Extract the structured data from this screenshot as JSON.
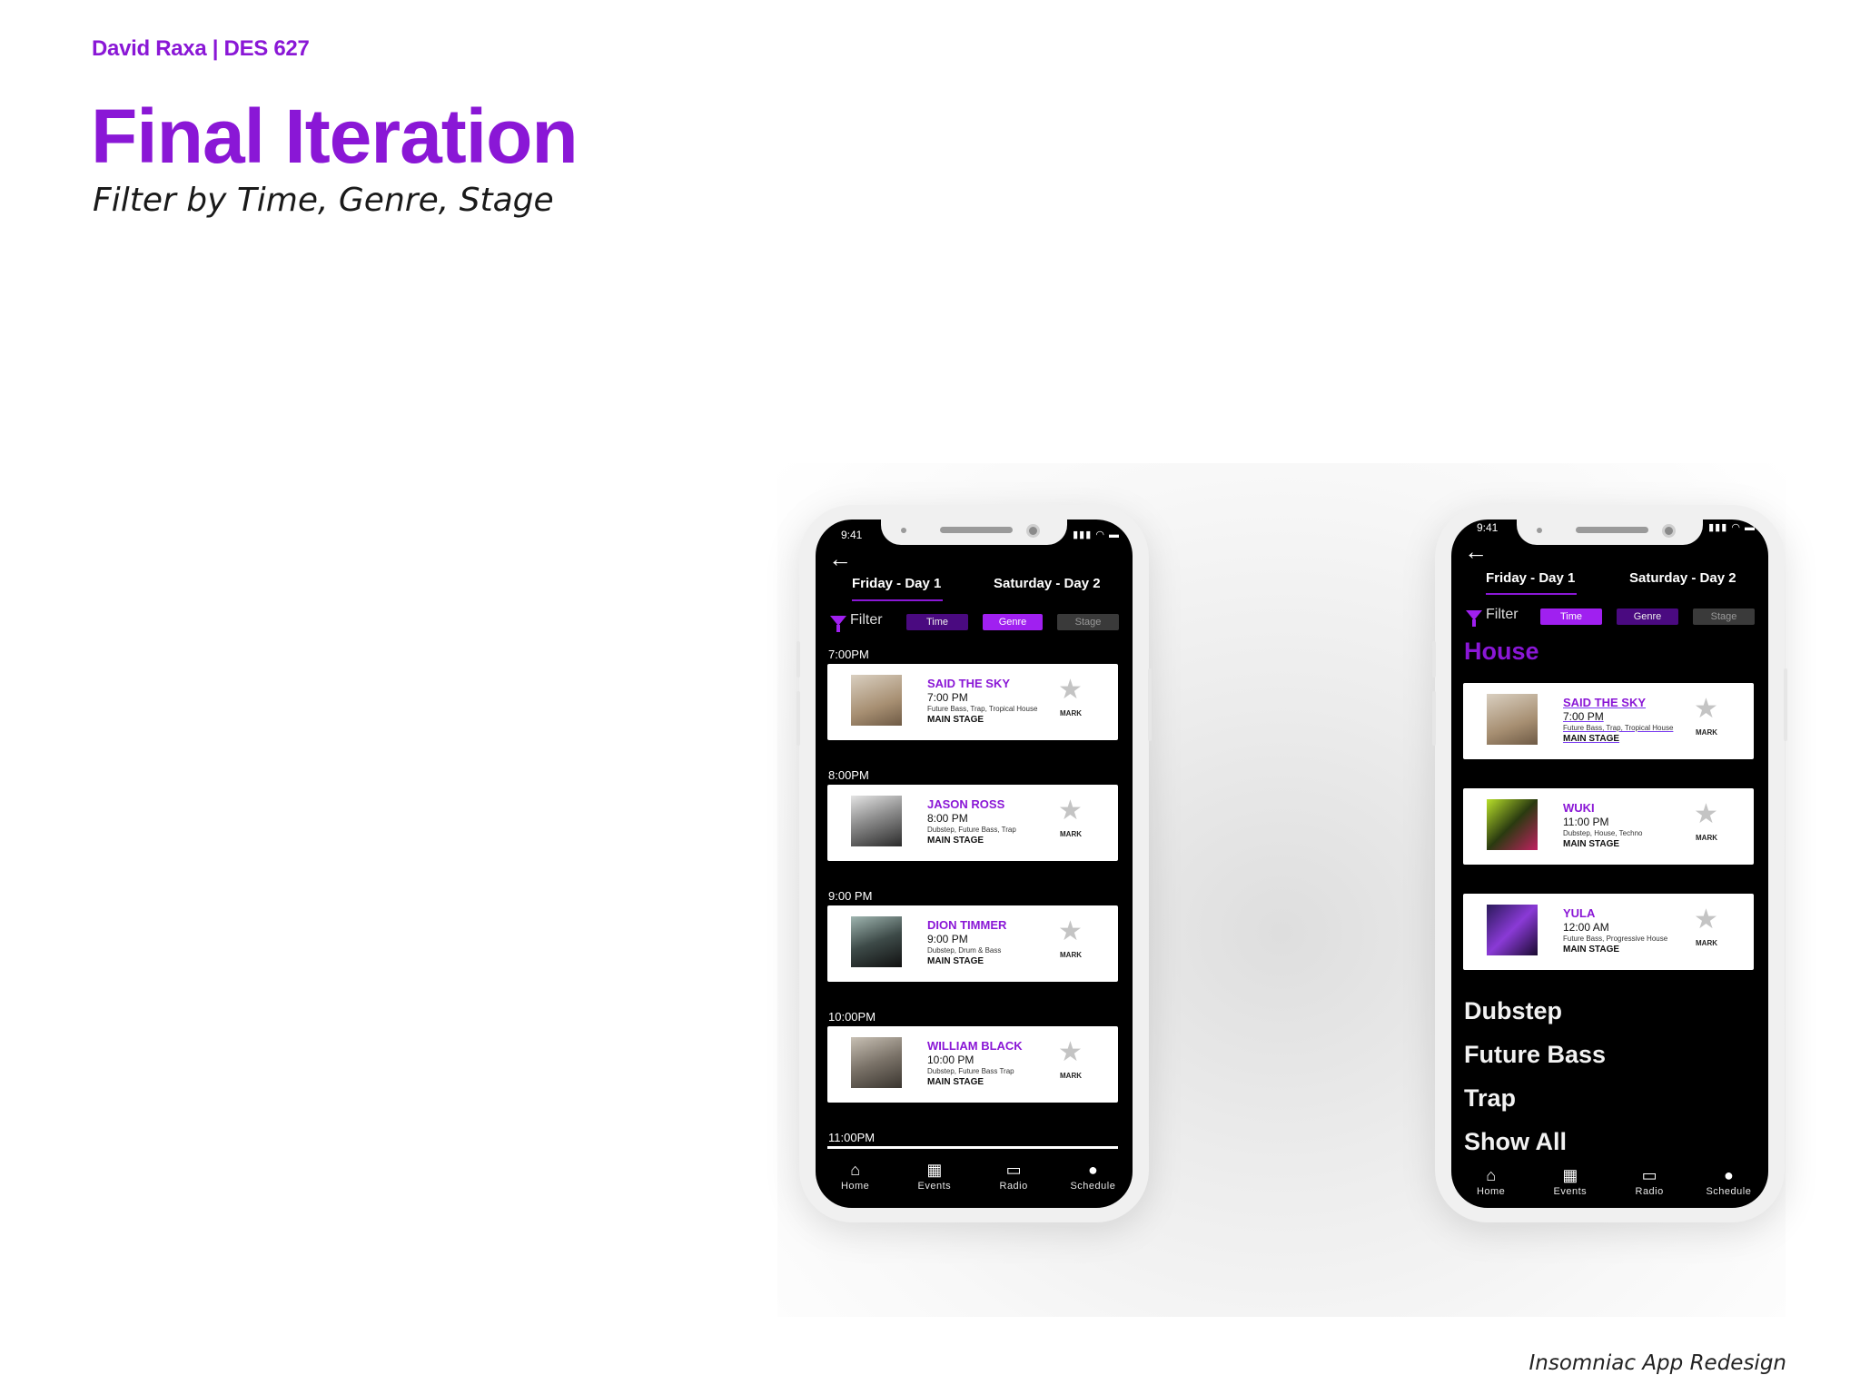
{
  "header": {
    "author": "David Raxa | DES 627",
    "title": "Final Iteration",
    "subtitle": "Filter by Time, Genre, Stage"
  },
  "footer": "Insomniac App Redesign",
  "colors": {
    "accent": "#8a17d6",
    "chip_bright": "#a020f0",
    "chip_dark": "#4a0a80"
  },
  "phone_left": {
    "status_time": "9:41",
    "tabs": [
      "Friday - Day 1",
      "Saturday - Day 2"
    ],
    "filter_label": "Filter",
    "chips": [
      "Time",
      "Genre",
      "Stage"
    ],
    "slots": [
      {
        "time": "7:00PM",
        "artist": "SAID THE SKY",
        "set_time": "7:00 PM",
        "genres": "Future Bass, Trap, Tropical House",
        "stage": "MAIN STAGE",
        "mark": "MARK"
      },
      {
        "time": "8:00PM",
        "artist": "JASON ROSS",
        "set_time": "8:00 PM",
        "genres": "Dubstep, Future Bass, Trap",
        "stage": "MAIN STAGE",
        "mark": "MARK"
      },
      {
        "time": "9:00 PM",
        "artist": "DION TIMMER",
        "set_time": "9:00 PM",
        "genres": "Dubstep, Drum & Bass",
        "stage": "MAIN STAGE",
        "mark": "MARK"
      },
      {
        "time": "10:00PM",
        "artist": "WILLIAM BLACK",
        "set_time": "10:00 PM",
        "genres": "Dubstep, Future Bass Trap",
        "stage": "MAIN STAGE",
        "mark": "MARK"
      }
    ],
    "next_time": "11:00PM",
    "nav": [
      "Home",
      "Events",
      "Radio",
      "Schedule"
    ]
  },
  "phone_right": {
    "status_time": "9:41",
    "tabs": [
      "Friday - Day 1",
      "Saturday - Day 2"
    ],
    "filter_label": "Filter",
    "chips": [
      "Time",
      "Genre",
      "Stage"
    ],
    "genre_heading": "House",
    "cards": [
      {
        "artist": "SAID THE SKY",
        "set_time": "7:00 PM",
        "genres": "Future Bass, Trap, Tropical House",
        "stage": "MAIN STAGE",
        "mark": "MARK"
      },
      {
        "artist": "WUKI",
        "set_time": "11:00 PM",
        "genres": "Dubstep, House, Techno",
        "stage": "MAIN STAGE",
        "mark": "MARK"
      },
      {
        "artist": "YULA",
        "set_time": "12:00 AM",
        "genres": "Future Bass, Progressive House",
        "stage": "MAIN STAGE",
        "mark": "MARK"
      }
    ],
    "genre_list": [
      "Dubstep",
      "Future Bass",
      "Trap",
      "Show All"
    ],
    "nav": [
      "Home",
      "Events",
      "Radio",
      "Schedule"
    ]
  }
}
